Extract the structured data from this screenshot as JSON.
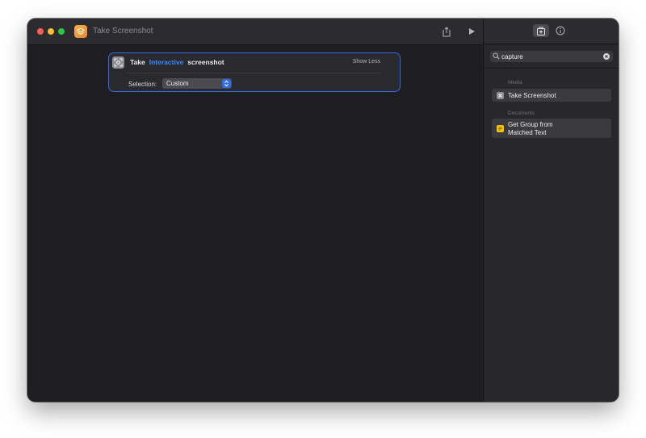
{
  "window": {
    "title": "Take Screenshot"
  },
  "action": {
    "verb": "Take",
    "token": "Interactive",
    "noun": "screenshot",
    "show_less_label": "Show Less",
    "selection_label": "Selection:",
    "selection_value": "Custom"
  },
  "sidebar": {
    "search_value": "capture",
    "sections": [
      {
        "label": "Media",
        "results": [
          {
            "label": "Take Screenshot",
            "icon": "screenshot-icon",
            "icon_color": "#8e8e93"
          }
        ]
      },
      {
        "label": "Documents",
        "results": [
          {
            "label_line1": "Get Group from",
            "label_line2": "Matched Text",
            "icon": "text-document-icon",
            "icon_color": "#f5c400"
          }
        ]
      }
    ]
  },
  "colors": {
    "accent": "#2f6ee6",
    "token": "#3a8bff",
    "app_icon": "#f0a03a",
    "traffic_red": "#ff5f57",
    "traffic_yellow": "#febc2e",
    "traffic_green": "#28c840"
  },
  "icons": {
    "app": "shortcuts-icon",
    "share": "share-icon",
    "run": "play-icon",
    "library": "add-to-library-icon",
    "info": "info-icon",
    "search": "search-icon",
    "clear": "clear-icon"
  }
}
